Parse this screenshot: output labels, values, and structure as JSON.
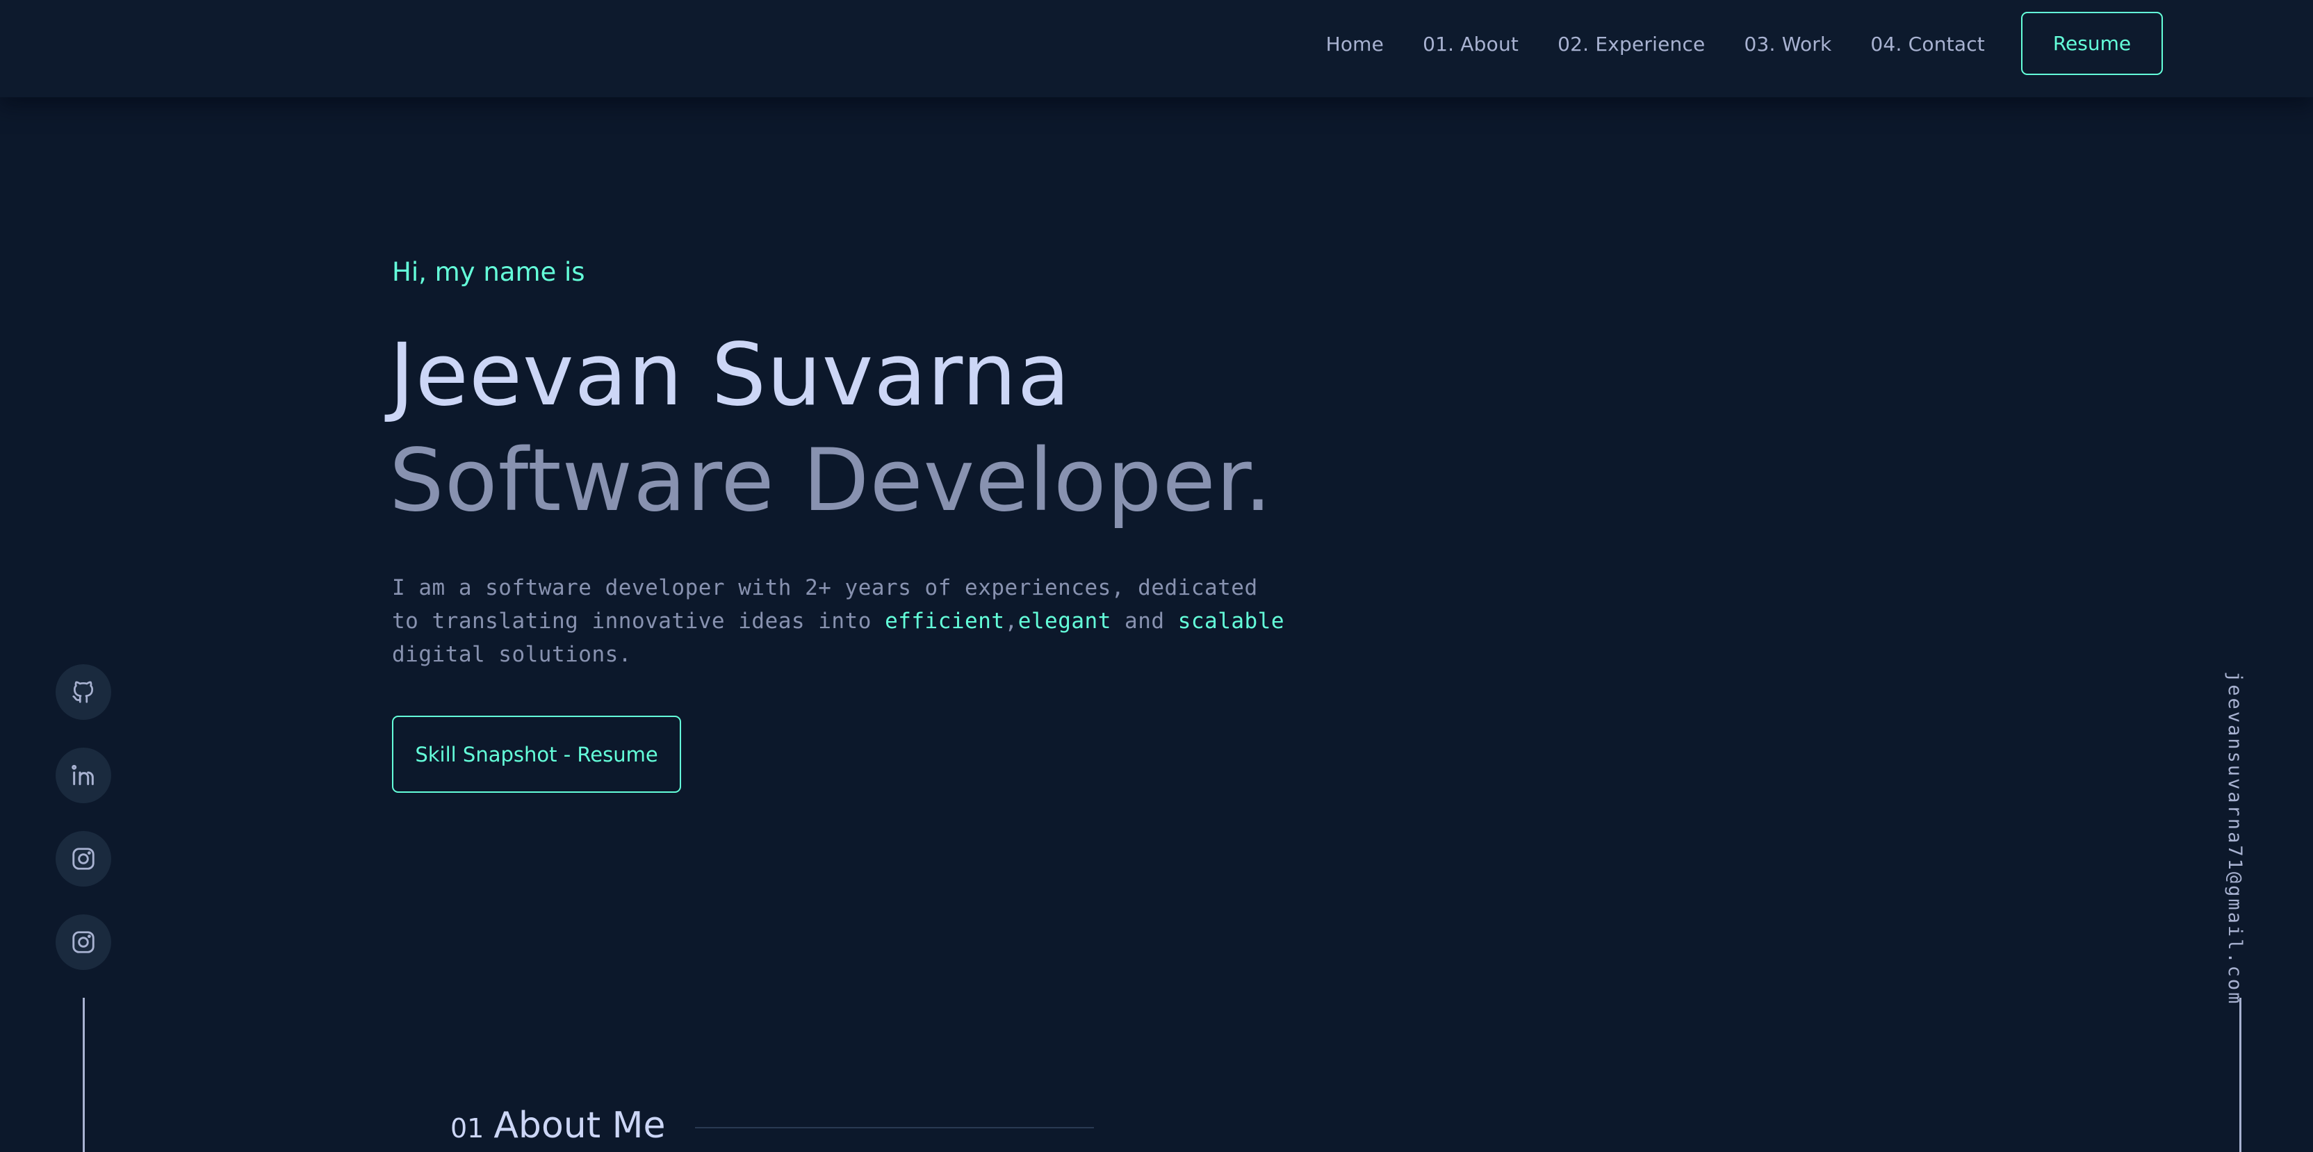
{
  "nav": {
    "links": [
      "Home",
      "01. About",
      "02. Experience",
      "03. Work",
      "04. Contact"
    ],
    "resume_label": "Resume"
  },
  "hero": {
    "greeting": "Hi, my name is",
    "name": "Jeevan Suvarna",
    "role": "Software Developer.",
    "description": {
      "line1": "I am a software developer with 2+ years of experiences, dedicated",
      "line2_prefix": "to translating innovative ideas into ",
      "highlight1": "efficient",
      "separator": ",",
      "highlight2": "elegant",
      "conjunction": " and ",
      "highlight3": "scalable",
      "line3": "digital solutions."
    },
    "cta_label": "Skill Snapshot - Resume"
  },
  "social": {
    "icons": [
      "github-icon",
      "linkedin-icon",
      "instagram-icon",
      "instagram-icon"
    ]
  },
  "email": "jeevansuvarna71@gmail.com",
  "about": {
    "number": "01",
    "title": "About Me"
  },
  "colors": {
    "background": "#0c182b",
    "accent": "#64ffda",
    "heading": "#ccd6f6",
    "muted": "#8892b0"
  }
}
